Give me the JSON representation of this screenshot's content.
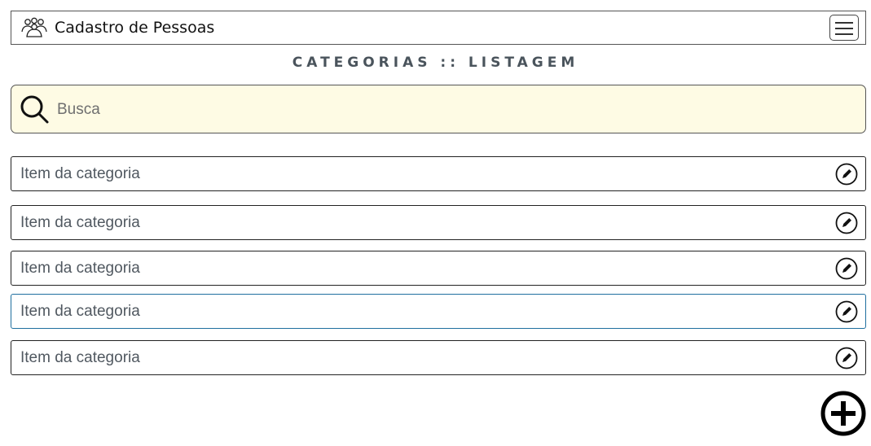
{
  "navbar": {
    "brand_icon": "people-group-icon",
    "title": "Cadastro de Pessoas",
    "menu_icon": "hamburger-icon"
  },
  "page": {
    "heading": "CATEGORIAS :: LISTAGEM"
  },
  "search": {
    "icon": "search-icon",
    "placeholder": "Busca",
    "value": "",
    "background_color": "#fefbe4"
  },
  "items": [
    {
      "label": "Item da categoria",
      "action_icon": "edit-icon"
    },
    {
      "label": "Item da categoria",
      "action_icon": "edit-icon"
    },
    {
      "label": "Item da categoria",
      "action_icon": "edit-icon"
    },
    {
      "label": "Item da categoria",
      "action_icon": "edit-icon"
    },
    {
      "label": "Item da categoria",
      "action_icon": "edit-icon"
    }
  ],
  "add_button": {
    "icon": "add-circle-icon"
  },
  "colors": {
    "heading": "#4a545c",
    "focus_border": "#1f6f9f"
  }
}
